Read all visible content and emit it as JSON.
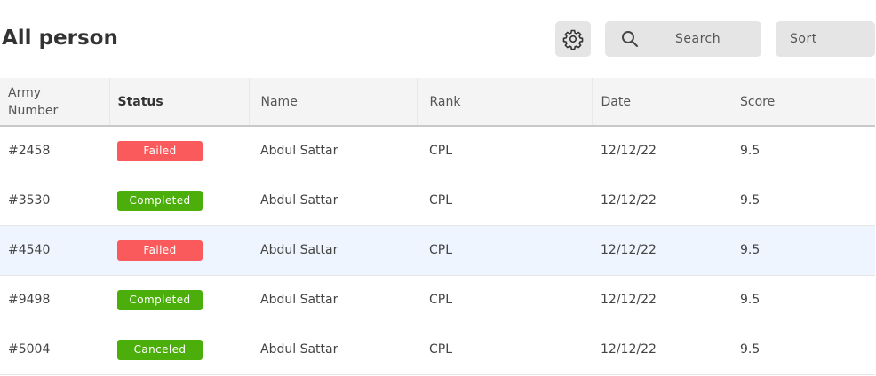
{
  "header": {
    "title": "All person",
    "search_label": "Search",
    "sort_label": "Sort"
  },
  "table": {
    "columns": [
      "Army Number",
      "Status",
      "Name",
      "Rank",
      "Date",
      "Score"
    ],
    "rows": [
      {
        "army_number": "#2458",
        "status": "Failed",
        "name": "Abdul Sattar",
        "rank": "CPL",
        "date": "12/12/22",
        "score": "9.5"
      },
      {
        "army_number": "#3530",
        "status": "Completed",
        "name": "Abdul Sattar",
        "rank": "CPL",
        "date": "12/12/22",
        "score": "9.5"
      },
      {
        "army_number": "#4540",
        "status": "Failed",
        "name": "Abdul Sattar",
        "rank": "CPL",
        "date": "12/12/22",
        "score": "9.5"
      },
      {
        "army_number": "#9498",
        "status": "Completed",
        "name": "Abdul Sattar",
        "rank": "CPL",
        "date": "12/12/22",
        "score": "9.5"
      },
      {
        "army_number": "#5004",
        "status": "Canceled",
        "name": "Abdul Sattar",
        "rank": "CPL",
        "date": "12/12/22",
        "score": "9.5"
      }
    ]
  },
  "colors": {
    "failed": "#fb5a5c",
    "completed": "#4cae0a",
    "canceled": "#4cae0a",
    "highlight_row": "#eef5fe"
  },
  "icons": {
    "settings": "gear-icon",
    "search": "search-icon"
  }
}
